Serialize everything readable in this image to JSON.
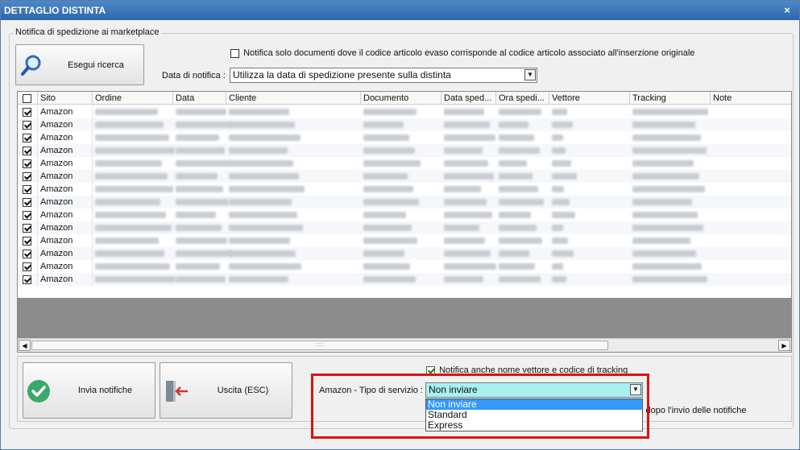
{
  "window": {
    "title": "DETTAGLIO DISTINTA",
    "close_glyph": "×"
  },
  "notify_group": {
    "legend": "Notifica di spedizione ai marketplace",
    "search_button": "Esegui ricerca",
    "only_docs_checkbox_label": "Notifica solo documenti dove il codice articolo evaso corrisponde al codice articolo associato all'inserzione originale",
    "only_docs_checked": false,
    "date_label": "Data di notifica :",
    "date_value": "Utilizza la data di spedizione presente sulla distinta"
  },
  "grid": {
    "columns": [
      "",
      "Sito",
      "Ordine",
      "Data",
      "Cliente",
      "Documento",
      "Data sped...",
      "Ora spedi...",
      "Vettore",
      "Tracking",
      "Note"
    ],
    "rows": [
      {
        "checked": true,
        "sito": "Amazon"
      },
      {
        "checked": true,
        "sito": "Amazon"
      },
      {
        "checked": true,
        "sito": "Amazon"
      },
      {
        "checked": true,
        "sito": "Amazon"
      },
      {
        "checked": true,
        "sito": "Amazon"
      },
      {
        "checked": true,
        "sito": "Amazon"
      },
      {
        "checked": true,
        "sito": "Amazon"
      },
      {
        "checked": true,
        "sito": "Amazon"
      },
      {
        "checked": true,
        "sito": "Amazon"
      },
      {
        "checked": true,
        "sito": "Amazon"
      },
      {
        "checked": true,
        "sito": "Amazon"
      },
      {
        "checked": true,
        "sito": "Amazon"
      },
      {
        "checked": true,
        "sito": "Amazon"
      },
      {
        "checked": true,
        "sito": "Amazon"
      }
    ]
  },
  "bottom": {
    "send_button": "Invia notifiche",
    "exit_button": "Uscita (ESC)",
    "carrier_checkbox_label": "Notifica anche nome vettore e codice di tracking",
    "carrier_checked": true,
    "service_label": "Amazon - Tipo di servizio :",
    "service_value": "Non inviare",
    "service_options": [
      "Non inviare",
      "Standard",
      "Express"
    ],
    "partial_hidden_text": "i dopo l'invio delle notifiche"
  },
  "icons": {
    "search": "magnifier-icon",
    "send": "green-check-icon",
    "exit": "exit-door-icon"
  },
  "colors": {
    "title_bar": "#2e66ab",
    "selected_option": "#3399ff",
    "highlight_border": "#e01010",
    "combo_active_bg": "#a9f0f0",
    "send_icon_green": "#3aa86a"
  }
}
